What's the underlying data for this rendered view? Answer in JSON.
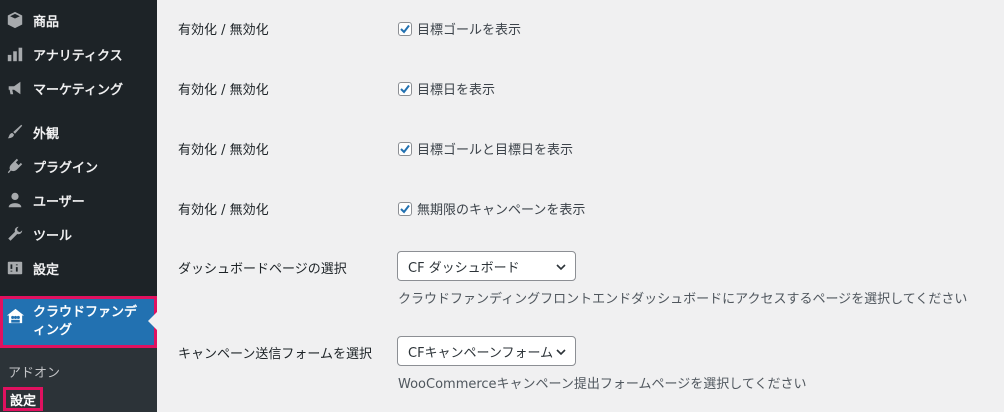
{
  "sidebar": {
    "items": [
      {
        "label": "商品",
        "icon": "box-icon"
      },
      {
        "label": "アナリティクス",
        "icon": "chart-bar-icon"
      },
      {
        "label": "マーケティング",
        "icon": "megaphone-icon"
      },
      {
        "label": "外観",
        "icon": "paintbrush-icon"
      },
      {
        "label": "プラグイン",
        "icon": "plugin-icon"
      },
      {
        "label": "ユーザー",
        "icon": "user-icon"
      },
      {
        "label": "ツール",
        "icon": "wrench-icon"
      },
      {
        "label": "設定",
        "icon": "settings-icon"
      }
    ],
    "active": {
      "label": "クラウドファンディング",
      "icon": "crowdfunding-icon"
    },
    "submenu": {
      "addon": "アドオン",
      "settings": "設定"
    }
  },
  "settings": {
    "rows": [
      {
        "label": "有効化 / 無効化",
        "option": "目標ゴールを表示",
        "checked": true
      },
      {
        "label": "有効化 / 無効化",
        "option": "目標日を表示",
        "checked": true
      },
      {
        "label": "有効化 / 無効化",
        "option": "目標ゴールと目標日を表示",
        "checked": true
      },
      {
        "label": "有効化 / 無効化",
        "option": "無期限のキャンペーンを表示",
        "checked": true
      }
    ],
    "dashboard": {
      "label": "ダッシュボードページの選択",
      "selected": "CF ダッシュボード",
      "description": "クラウドファンディングフロントエンドダッシュボードにアクセスするページを選択してください"
    },
    "campaign_form": {
      "label": "キャンペーン送信フォームを選択",
      "selected": "CFキャンペーンフォーム",
      "description": "WooCommerceキャンペーン提出フォームページを選択してください"
    }
  },
  "colors": {
    "sidebar_bg": "#1d2327",
    "active_bg": "#2271b1",
    "highlight": "#e0115f",
    "content_bg": "#f0f0f1",
    "check": "#2271b1"
  }
}
